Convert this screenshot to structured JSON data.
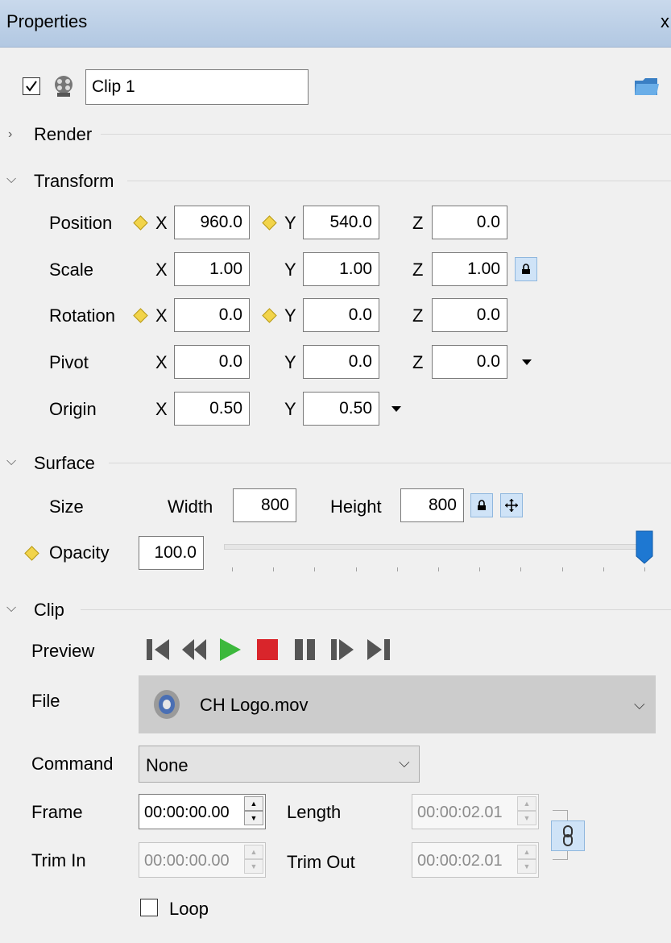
{
  "window": {
    "title": "Properties",
    "close": "x"
  },
  "header": {
    "enabled": true,
    "name_value": "Clip 1"
  },
  "sections": {
    "render": "Render",
    "transform": "Transform",
    "surface": "Surface",
    "clip": "Clip"
  },
  "transform": {
    "axis_x": "X",
    "axis_y": "Y",
    "axis_z": "Z",
    "position": {
      "label": "Position",
      "x": "960.0",
      "y": "540.0",
      "z": "0.0"
    },
    "scale": {
      "label": "Scale",
      "x": "1.00",
      "y": "1.00",
      "z": "1.00"
    },
    "rotation": {
      "label": "Rotation",
      "x": "0.0",
      "y": "0.0",
      "z": "0.0"
    },
    "pivot": {
      "label": "Pivot",
      "x": "0.0",
      "y": "0.0",
      "z": "0.0"
    },
    "origin": {
      "label": "Origin",
      "x": "0.50",
      "y": "0.50"
    }
  },
  "surface": {
    "size_label": "Size",
    "width_label": "Width",
    "width": "800",
    "height_label": "Height",
    "height": "800",
    "opacity_label": "Opacity",
    "opacity": "100.0",
    "opacity_slider_fraction": 1.0
  },
  "clip": {
    "preview_label": "Preview",
    "file_label": "File",
    "file_name": "CH Logo.mov",
    "command_label": "Command",
    "command_value": "None",
    "frame_label": "Frame",
    "frame": "00:00:00.00",
    "length_label": "Length",
    "length": "00:00:02.01",
    "trim_in_label": "Trim In",
    "trim_in": "00:00:00.00",
    "trim_out_label": "Trim Out",
    "trim_out": "00:00:02.01",
    "loop_label": "Loop",
    "loop": false
  },
  "colors": {
    "accent": "#1e78d2",
    "play": "#3cb83c",
    "stop": "#d9252b",
    "keyframe": "#f2d44a"
  }
}
